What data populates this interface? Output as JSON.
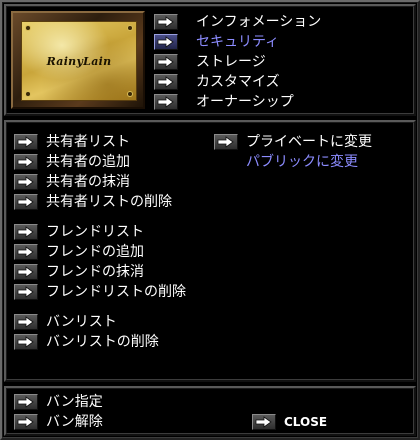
{
  "plate": {
    "name": "RainyLain"
  },
  "tabs": [
    {
      "label": "インフォメーション",
      "selected": false
    },
    {
      "label": "セキュリティ",
      "selected": true
    },
    {
      "label": "ストレージ",
      "selected": false
    },
    {
      "label": "カスタマイズ",
      "selected": false
    },
    {
      "label": "オーナーシップ",
      "selected": false
    }
  ],
  "sharers": [
    {
      "label": "共有者リスト"
    },
    {
      "label": "共有者の追加"
    },
    {
      "label": "共有者の抹消"
    },
    {
      "label": "共有者リストの削除"
    }
  ],
  "privacy": {
    "private_label": "プライベートに変更",
    "public_label": "パブリックに変更"
  },
  "friends": [
    {
      "label": "フレンドリスト"
    },
    {
      "label": "フレンドの追加"
    },
    {
      "label": "フレンドの抹消"
    },
    {
      "label": "フレンドリストの削除"
    }
  ],
  "bans": [
    {
      "label": "バンリスト"
    },
    {
      "label": "バンリストの削除"
    }
  ],
  "ban_actions": [
    {
      "label": "バン指定"
    },
    {
      "label": "バン解除"
    }
  ],
  "close_label": "CLOSE",
  "colors": {
    "selected_text": "#8c8cff",
    "link_text": "#8c8cff",
    "background": "#000000"
  }
}
